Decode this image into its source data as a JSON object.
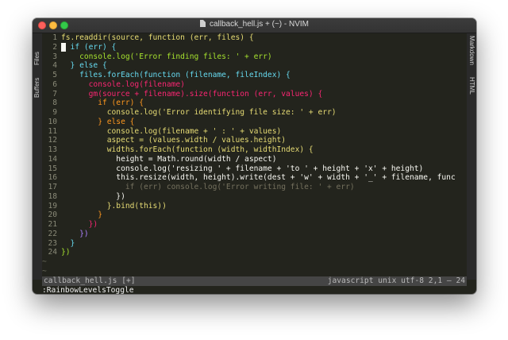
{
  "window": {
    "title": "callback_hell.js + (~) - NVIM"
  },
  "sidebar_left": {
    "tabs": [
      "Files",
      "Buffers"
    ]
  },
  "sidebar_right": {
    "tabs": [
      "Markdown",
      "HTML"
    ]
  },
  "editor": {
    "lines": [
      {
        "n": "1",
        "text": "fs.readdir(source, function (err, files) {",
        "color": "#e6db74"
      },
      {
        "n": "2",
        "text": "  if (err) {",
        "color": "#66d9ef",
        "cursor": true
      },
      {
        "n": "3",
        "text": "    console.log('Error finding files: ' + err)",
        "color": "#a6e22e"
      },
      {
        "n": "4",
        "text": "  } else {",
        "color": "#66d9ef"
      },
      {
        "n": "5",
        "text": "    files.forEach(function (filename, fileIndex) {",
        "color": "#66d9ef"
      },
      {
        "n": "6",
        "text": "      console.log(filename)",
        "color": "#f92672"
      },
      {
        "n": "7",
        "text": "      gm(source + filename).size(function (err, values) {",
        "color": "#f92672"
      },
      {
        "n": "8",
        "text": "        if (err) {",
        "color": "#fd971f"
      },
      {
        "n": "9",
        "text": "          console.log('Error identifying file size: ' + err)",
        "color": "#e6db74"
      },
      {
        "n": "10",
        "text": "        } else {",
        "color": "#fd971f"
      },
      {
        "n": "11",
        "text": "          console.log(filename + ' : ' + values)",
        "color": "#e6db74"
      },
      {
        "n": "12",
        "text": "          aspect = (values.width / values.height)",
        "color": "#e6db74"
      },
      {
        "n": "13",
        "text": "          widths.forEach(function (width, widthIndex) {",
        "color": "#e6db74"
      },
      {
        "n": "14",
        "text": "            height = Math.round(width / aspect)",
        "color": "#f8f8f2"
      },
      {
        "n": "15",
        "text": "            console.log('resizing ' + filename + 'to ' + height + 'x' + height)",
        "color": "#f8f8f2"
      },
      {
        "n": "16",
        "text": "            this.resize(width, height).write(dest + 'w' + width + '_' + filename, func",
        "color": "#f8f8f2"
      },
      {
        "n": "17",
        "text": "              if (err) console.log('Error writing file: ' + err)",
        "color": "#75715e"
      },
      {
        "n": "18",
        "text": "            })",
        "color": "#f8f8f2"
      },
      {
        "n": "19",
        "text": "          }.bind(this))",
        "color": "#e6db74"
      },
      {
        "n": "20",
        "text": "        }",
        "color": "#fd971f"
      },
      {
        "n": "21",
        "text": "      })",
        "color": "#f92672"
      },
      {
        "n": "22",
        "text": "    })",
        "color": "#ae81ff"
      },
      {
        "n": "23",
        "text": "  }",
        "color": "#66d9ef"
      },
      {
        "n": "24",
        "text": "})",
        "color": "#a6e22e"
      }
    ],
    "tildes": [
      "~",
      "~"
    ]
  },
  "status": {
    "left": "callback_hell.js [+]",
    "right": "javascript unix utf-8 2,1 — 24"
  },
  "command": ":RainbowLevelsToggle"
}
